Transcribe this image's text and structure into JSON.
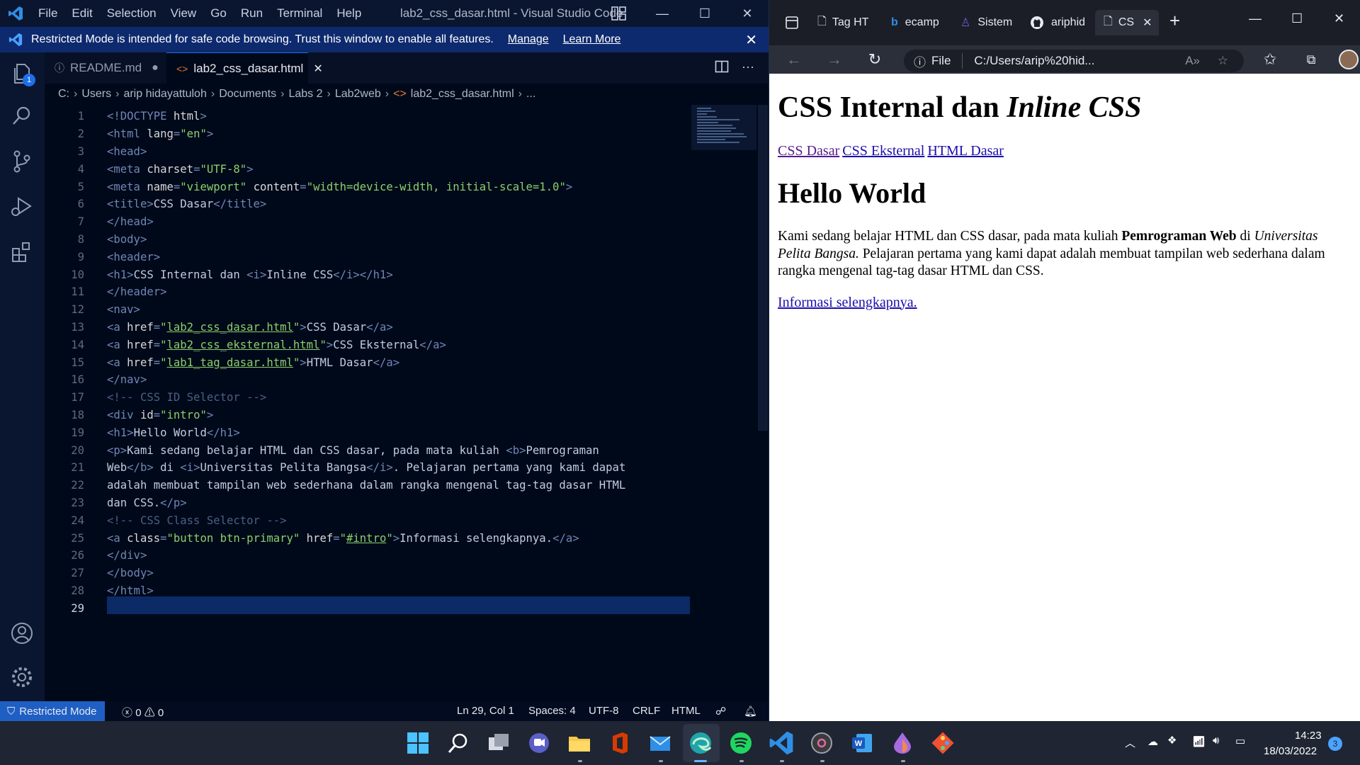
{
  "vscode": {
    "menu": [
      "File",
      "Edit",
      "Selection",
      "View",
      "Go",
      "Run",
      "Terminal",
      "Help"
    ],
    "window_title": "lab2_css_dasar.html - Visual Studio Code",
    "banner": {
      "text": "Restricted Mode is intended for safe code browsing. Trust this window to enable all features.",
      "manage": "Manage",
      "learn_more": "Learn More"
    },
    "explorer_badge": "1",
    "tabs": [
      {
        "label": "README.md"
      },
      {
        "label": "lab2_css_dasar.html"
      }
    ],
    "breadcrumb": [
      "C:",
      "Users",
      "arip hidayattuloh",
      "Documents",
      "Labs 2",
      "Lab2web",
      "lab2_css_dasar.html",
      "..."
    ],
    "status": {
      "restricted": "Restricted Mode",
      "errors": "0",
      "warnings": "0",
      "position": "Ln 29, Col 1",
      "spaces": "Spaces: 4",
      "encoding": "UTF-8",
      "eol": "CRLF",
      "language": "HTML"
    }
  },
  "browser": {
    "tabs": [
      {
        "label": "Tag HT"
      },
      {
        "label": "ecamp"
      },
      {
        "label": "Sistem"
      },
      {
        "label": "ariphid"
      },
      {
        "label": "CS"
      }
    ],
    "address_prefix": "File",
    "address": "C:/Users/arip%20hid...",
    "page": {
      "title_plain": "CSS Internal dan ",
      "title_italic": "Inline CSS",
      "nav_links": [
        "CSS Dasar",
        "CSS Eksternal",
        "HTML Dasar"
      ],
      "heading": "Hello World",
      "para_1": "Kami sedang belajar HTML dan CSS dasar, pada mata kuliah ",
      "para_bold": "Pemrograman Web",
      "para_2": " di ",
      "para_italic": "Universitas Pelita Bangsa.",
      "para_3": " Pelajaran pertama yang kami dapat adalah membuat tampilan web sederhana dalam rangka mengenal tag-tag dasar HTML dan CSS.",
      "more_link": "Informasi selengkapnya."
    }
  },
  "taskbar": {
    "time": "14:23",
    "date": "18/03/2022",
    "notifications": "3"
  }
}
